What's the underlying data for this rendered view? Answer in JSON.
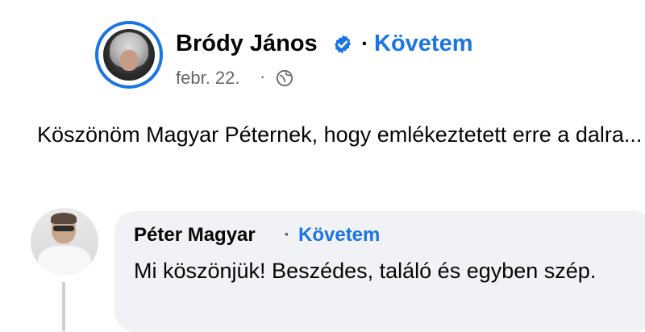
{
  "post": {
    "author_name": "Bródy János",
    "separator": "·",
    "follow_label": "Követem",
    "date": "febr. 22.",
    "date_separator": "·",
    "text": "Köszönöm Magyar Péternek, hogy emlékeztetett erre a dalra...",
    "icons": {
      "verified": "verified-badge-icon",
      "audience": "globe-icon"
    }
  },
  "comment": {
    "author_name": "Péter Magyar",
    "separator": "·",
    "follow_label": "Követem",
    "text": "Mi köszönjük! Beszédes, találó és egyben szép."
  },
  "colors": {
    "accent": "#1b74e4",
    "muted_text": "#65676b",
    "bubble_bg": "#f0f2f5",
    "text": "#050505"
  }
}
